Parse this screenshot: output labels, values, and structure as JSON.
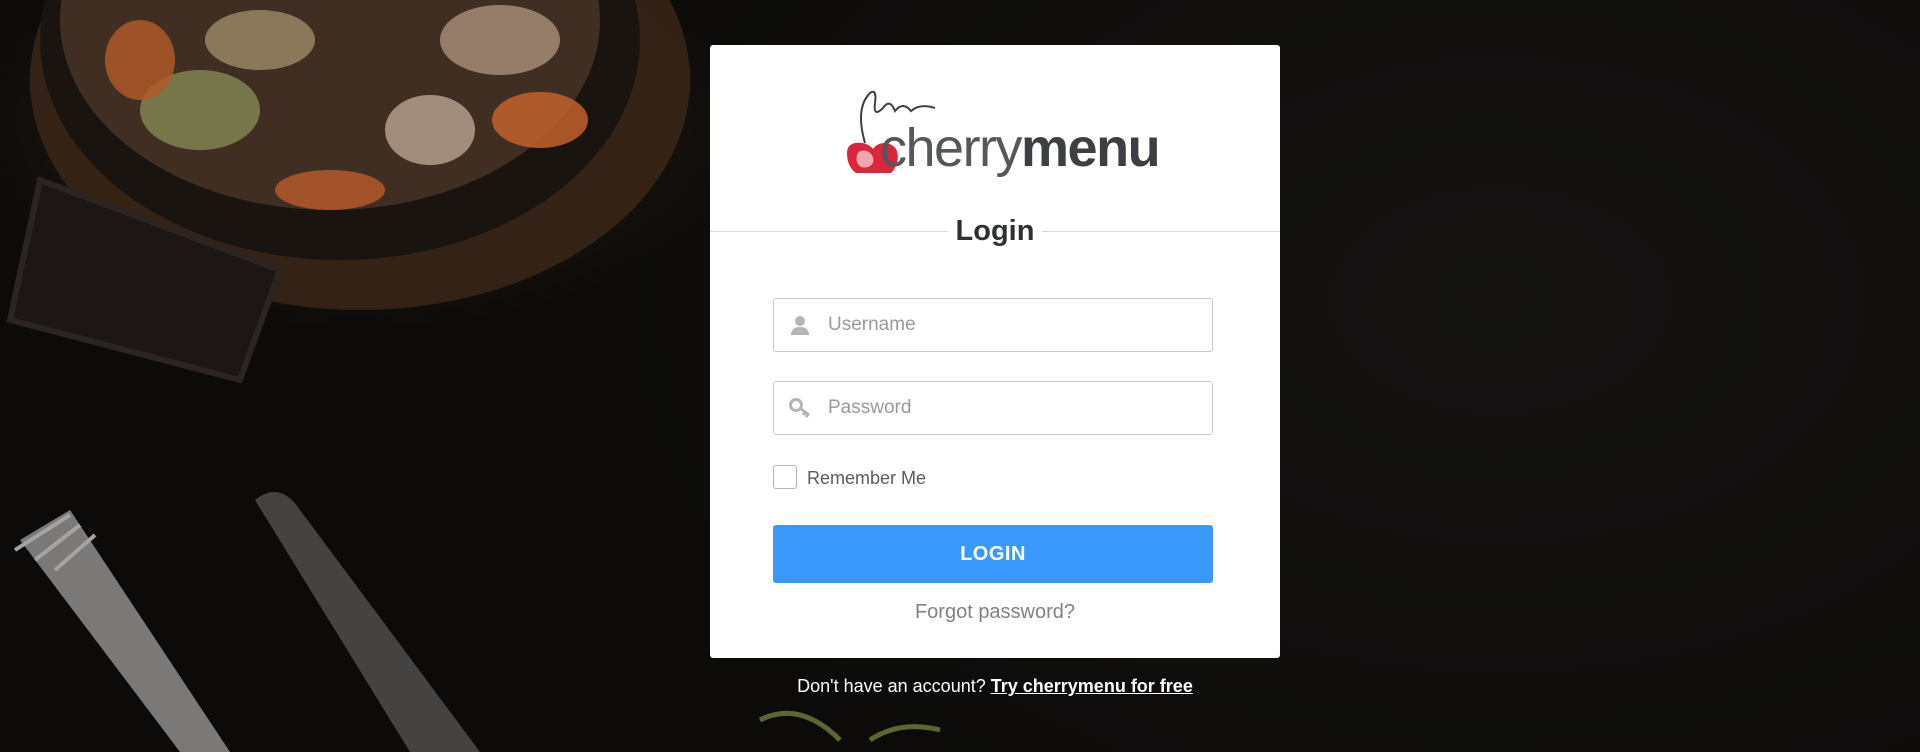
{
  "brand": {
    "name_part1": "cherry",
    "name_part2": "menu",
    "logo_icon": "cherry-icon",
    "logo_color": "#d9263b"
  },
  "form": {
    "title": "Login",
    "username_placeholder": "Username",
    "username_value": "",
    "password_placeholder": "Password",
    "password_value": "",
    "remember_label": "Remember Me",
    "remember_checked": false,
    "login_label": "LOGIN",
    "forgot_label": "Forgot password?"
  },
  "signup": {
    "prompt": "Don't have an account?",
    "link_label": "Try cherrymenu for free"
  },
  "icons": {
    "username": "user-icon",
    "password": "key-icon"
  },
  "colors": {
    "accent": "#3a98fb",
    "background": "#0e0d0c",
    "card": "#ffffff"
  }
}
